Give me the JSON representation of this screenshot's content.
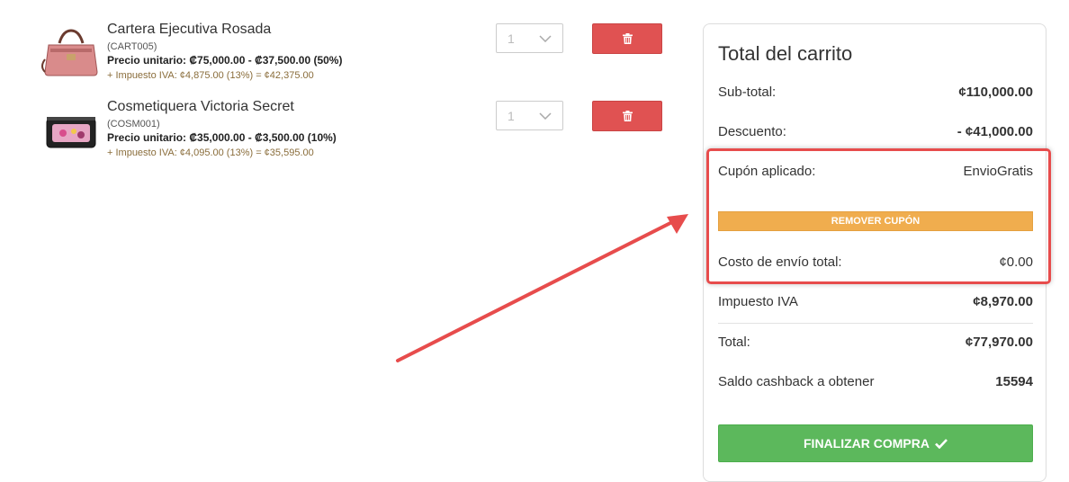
{
  "cart": {
    "items": [
      {
        "name": "Cartera Ejecutiva Rosada",
        "sku": "(CART005)",
        "price_line": "Precio unitario: ₡75,000.00 - ₡37,500.00 (50%)",
        "tax_line": "+ Impuesto IVA: ¢4,875.00 (13%) = ¢42,375.00",
        "qty": "1",
        "thumb_icon": "handbag-icon"
      },
      {
        "name": "Cosmetiquera Victoria Secret",
        "sku": "(COSM001)",
        "price_line": "Precio unitario: ₡35,000.00 - ₡3,500.00 (10%)",
        "tax_line": "+ Impuesto IVA: ¢4,095.00 (13%) = ¢35,595.00",
        "qty": "1",
        "thumb_icon": "cosmetic-bag-icon"
      }
    ]
  },
  "summary": {
    "title": "Total del carrito",
    "subtotal_label": "Sub-total:",
    "subtotal_value": "¢110,000.00",
    "discount_label": "Descuento:",
    "discount_value": "- ¢41,000.00",
    "coupon_label": "Cupón aplicado:",
    "coupon_value": "EnvioGratis",
    "remove_coupon_label": "REMOVER CUPÓN",
    "shipping_label": "Costo de envío total:",
    "shipping_value": "¢0.00",
    "tax_label": "Impuesto IVA",
    "tax_value": "¢8,970.00",
    "total_label": "Total:",
    "total_value": "¢77,970.00",
    "cashback_label": "Saldo cashback a obtener",
    "cashback_value": "15594",
    "checkout_label": "FINALIZAR COMPRA"
  },
  "colors": {
    "delete": "#e05252",
    "coupon_button": "#f0ad4e",
    "checkout_button": "#5cb85c",
    "annotation": "#e74c4c"
  }
}
